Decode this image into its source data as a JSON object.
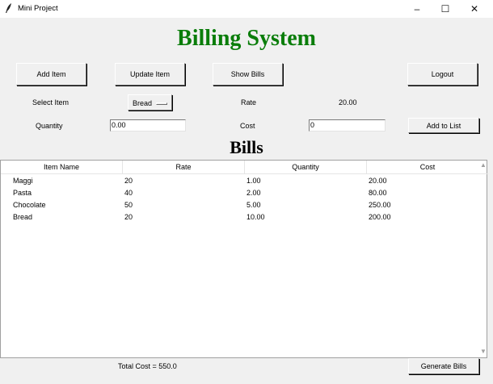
{
  "window": {
    "title": "Mini Project",
    "icon": "feather-icon",
    "controls": {
      "minimize": "–",
      "maximize": "☐",
      "close": "✕"
    }
  },
  "header": {
    "title": "Billing System",
    "color": "#0a7d0a"
  },
  "toolbar": {
    "add_item": "Add Item",
    "update_item": "Update Item",
    "show_bills": "Show Bills",
    "logout": "Logout"
  },
  "form": {
    "select_item_label": "Select Item",
    "selected_item": "Bread",
    "rate_label": "Rate",
    "rate_value": "20.00",
    "quantity_label": "Quantity",
    "quantity_value": "0.00",
    "cost_label": "Cost",
    "cost_value": "0",
    "add_to_list": "Add to List"
  },
  "bills": {
    "title": "Bills",
    "columns": [
      "Item Name",
      "Rate",
      "Quantity",
      "Cost"
    ],
    "rows": [
      [
        "Maggi",
        "20",
        "1.00",
        "20.00"
      ],
      [
        "Pasta",
        "40",
        "2.00",
        "80.00"
      ],
      [
        "Chocolate",
        "50",
        "5.00",
        "250.00"
      ],
      [
        "Bread",
        "20",
        "10.00",
        "200.00"
      ]
    ]
  },
  "footer": {
    "total": "Total Cost = 550.0",
    "generate_bills": "Generate Bills"
  }
}
